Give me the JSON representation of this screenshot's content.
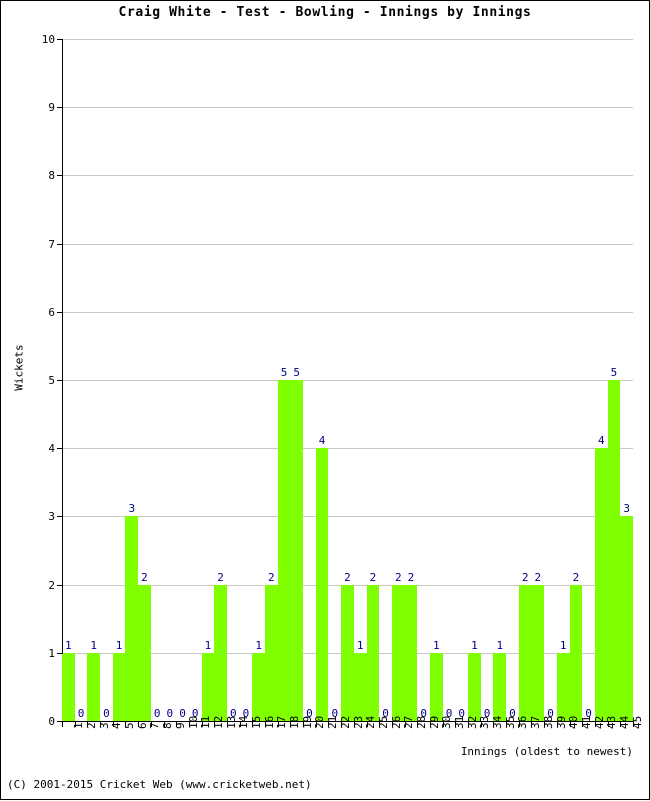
{
  "chart_data": {
    "type": "bar",
    "title": "Craig White - Test - Bowling - Innings by Innings",
    "xlabel": "Innings (oldest to newest)",
    "ylabel": "Wickets",
    "ylim": [
      0,
      10
    ],
    "yticks": [
      0,
      1,
      2,
      3,
      4,
      5,
      6,
      7,
      8,
      9,
      10
    ],
    "grid": true,
    "legend": null,
    "bar_color": "#80ff00",
    "label_color": "#000080",
    "categories": [
      "1",
      "2",
      "3",
      "4",
      "5",
      "6",
      "7",
      "8",
      "9",
      "10",
      "11",
      "12",
      "13",
      "14",
      "15",
      "16",
      "17",
      "18",
      "19",
      "20",
      "21",
      "22",
      "23",
      "24",
      "25",
      "26",
      "27",
      "28",
      "29",
      "30",
      "31",
      "32",
      "33",
      "34",
      "35",
      "36",
      "37",
      "38",
      "39",
      "40",
      "41",
      "42",
      "43",
      "44",
      "45"
    ],
    "values": [
      1,
      0,
      1,
      0,
      1,
      3,
      2,
      0,
      0,
      0,
      0,
      1,
      2,
      0,
      0,
      1,
      2,
      5,
      5,
      0,
      4,
      0,
      2,
      1,
      2,
      0,
      2,
      2,
      0,
      1,
      0,
      0,
      1,
      0,
      1,
      0,
      2,
      2,
      0,
      1,
      2,
      0,
      4,
      5,
      3
    ]
  },
  "footer": {
    "copyright": "(C) 2001-2015 Cricket Web (www.cricketweb.net)"
  }
}
